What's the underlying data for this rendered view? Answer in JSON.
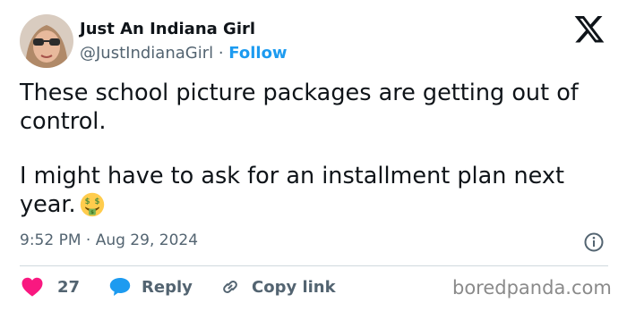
{
  "tweet": {
    "author": {
      "display_name": "Just An Indiana Girl",
      "handle": "@JustIndianaGirl",
      "separator": " · ",
      "follow_label": "Follow"
    },
    "text_paragraphs": [
      "These school picture packages are getting out of control.",
      "I might have to ask for an installment plan next year."
    ],
    "emoji": "money-mouth-face",
    "timestamp": "9:52 PM · Aug 29, 2024"
  },
  "actions": {
    "like_count": "27",
    "reply_label": "Reply",
    "copy_link_label": "Copy link"
  },
  "watermark": "boredpanda.com",
  "colors": {
    "text": "#0f1419",
    "secondary": "#536471",
    "follow": "#1d9bf0",
    "like": "#f91880",
    "reply": "#1d9bf0"
  },
  "icons": [
    "x-logo-icon",
    "info-icon",
    "heart-icon",
    "reply-bubble-icon",
    "link-icon"
  ]
}
